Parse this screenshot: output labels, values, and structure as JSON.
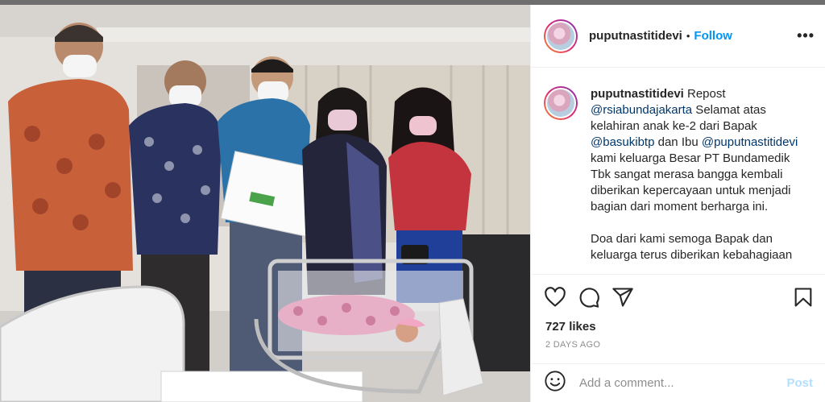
{
  "post": {
    "username": "puputnastitidevi",
    "separator": "•",
    "follow_label": "Follow",
    "more_label": "•••"
  },
  "caption": {
    "username": "puputnastitidevi",
    "line1_tail": " Repost",
    "mention1": "@rsiabundajakarta",
    "text1": " Selamat atas kelahiran anak ke-2 dari Bapak ",
    "mention2": "@basukibtp",
    "text2": " dan Ibu ",
    "mention3": "@puputnastitidevi",
    "text3": " kami keluarga Besar PT Bundamedik Tbk sangat merasa bangga kembali diberikan kepercayaan untuk menjadi bagian dari moment berharga ini.",
    "paragraph2": "Doa dari kami semoga Bapak dan keluarga terus diberikan kebahagiaan"
  },
  "stats": {
    "likes": "727 likes",
    "time": "2 DAYS AGO"
  },
  "comment": {
    "placeholder": "Add a comment...",
    "post_label": "Post"
  },
  "icons": {
    "like": "heart-icon",
    "comment": "comment-icon",
    "share": "share-icon",
    "save": "bookmark-icon",
    "emoji": "emoji-icon"
  },
  "colors": {
    "follow": "#0095f6",
    "post_disabled": "#b2dffc",
    "mention": "#00376b",
    "muted": "#8e8e8e"
  }
}
